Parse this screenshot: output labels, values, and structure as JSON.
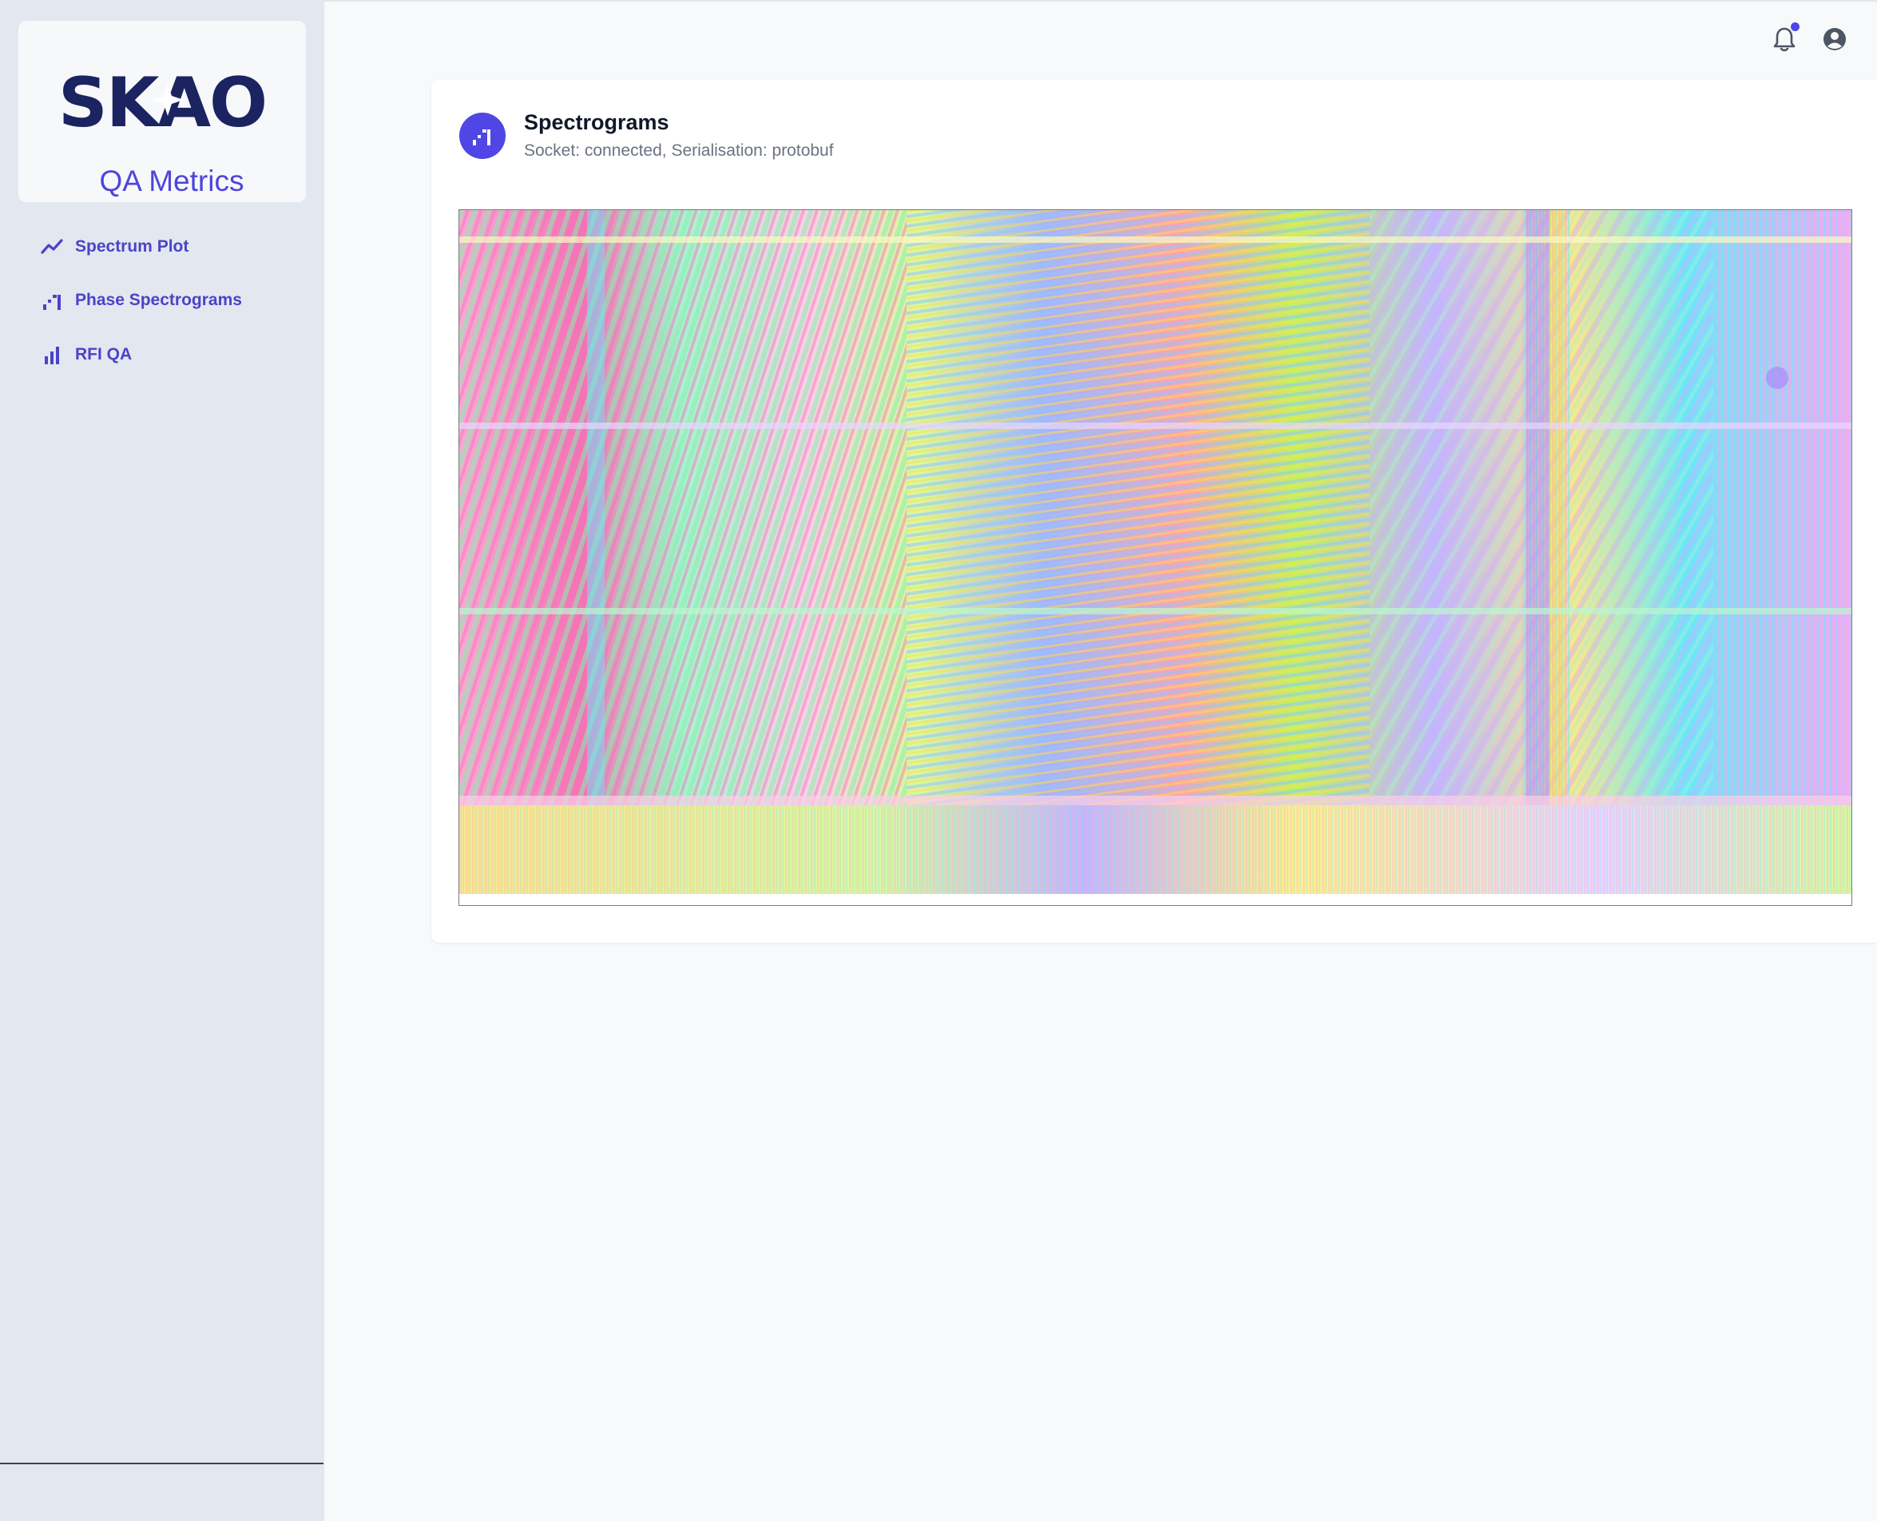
{
  "sidebar": {
    "logo_text": "SKAO",
    "app_title": "QA Metrics",
    "items": [
      {
        "label": "Spectrum Plot",
        "icon": "trend-line-icon"
      },
      {
        "label": "Phase Spectrograms",
        "icon": "steps-chart-icon"
      },
      {
        "label": "RFI QA",
        "icon": "bar-chart-icon"
      }
    ]
  },
  "topbar": {
    "icons": [
      "bell-icon",
      "user-circle-icon"
    ],
    "has_notification": true
  },
  "main": {
    "title": "Spectrograms",
    "status": "Socket: connected, Serialisation: protobuf",
    "icon": "steps-chart-icon"
  },
  "colors": {
    "accent": "#4f46e5",
    "sidebar_bg": "#e3e7ef",
    "page_bg": "#f8f9fb",
    "logo_navy": "#1b2461",
    "logo_pink": "#e8336f"
  }
}
